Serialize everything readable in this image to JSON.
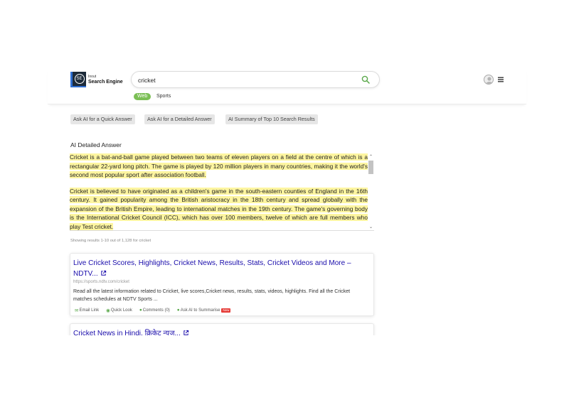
{
  "brand": {
    "line1": "Inout",
    "line2": "Search Engine",
    "mark": "SE"
  },
  "search": {
    "value": "cricket"
  },
  "tabs": [
    {
      "label": "Web",
      "active": true
    },
    {
      "label": "Sports",
      "active": false
    }
  ],
  "ai_buttons": [
    {
      "label": "Ask AI for a Quick Answer"
    },
    {
      "label": "Ask AI for a Detailed Answer"
    },
    {
      "label": "AI Summary of Top 10 Search Results"
    }
  ],
  "ai_answer": {
    "title": "AI Detailed Answer",
    "paragraphs": [
      "Cricket is a bat-and-ball game played between two teams of eleven players on a field at the centre of which is a rectangular 22-yard long pitch. The game is played by 120 million players in many countries, making it the world's second most popular sport after association football.",
      "Cricket is believed to have originated as a children's game in the south-eastern counties of England in the 16th century. It gained popularity among the British aristocracy in the 18th century and spread globally with the expansion of the British Empire, leading to international matches in the 19th century. The game's governing body is the International Cricket Council (ICC), which has over 100 members, twelve of which are full members who play Test cricket."
    ]
  },
  "results_count": "Showing results 1-10 out of 1,128 for cricket",
  "results": [
    {
      "title": "Live Cricket Scores, Highlights, Cricket News, Results, Stats, Cricket Videos and More – NDTV...",
      "url": "https://sports.ndtv.com/cricket",
      "snippet": "Read all the latest information related to Cricket, live scores,Cricket news, results, stats, videos, highlights. Find all the Cricket matches schedules at NDTV Sports ...",
      "actions": {
        "email": "Email Link",
        "quick": "Quick Look",
        "comments": "Comments (0)",
        "ask_ai": "Ask AI to Summarise",
        "badge": "New"
      }
    },
    {
      "title": "Cricket News in Hindi, क्रिकेट न्यूज़..."
    }
  ],
  "colors": {
    "accent_green": "#7bbf55",
    "link_blue": "#1a0dab",
    "highlight": "#fdf5a0",
    "badge_red": "#e53935"
  },
  "icons": [
    "search-icon",
    "user-avatar-icon",
    "hamburger-menu-icon",
    "external-link-icon",
    "envelope-icon",
    "eye-icon",
    "comments-icon",
    "chat-icon"
  ]
}
